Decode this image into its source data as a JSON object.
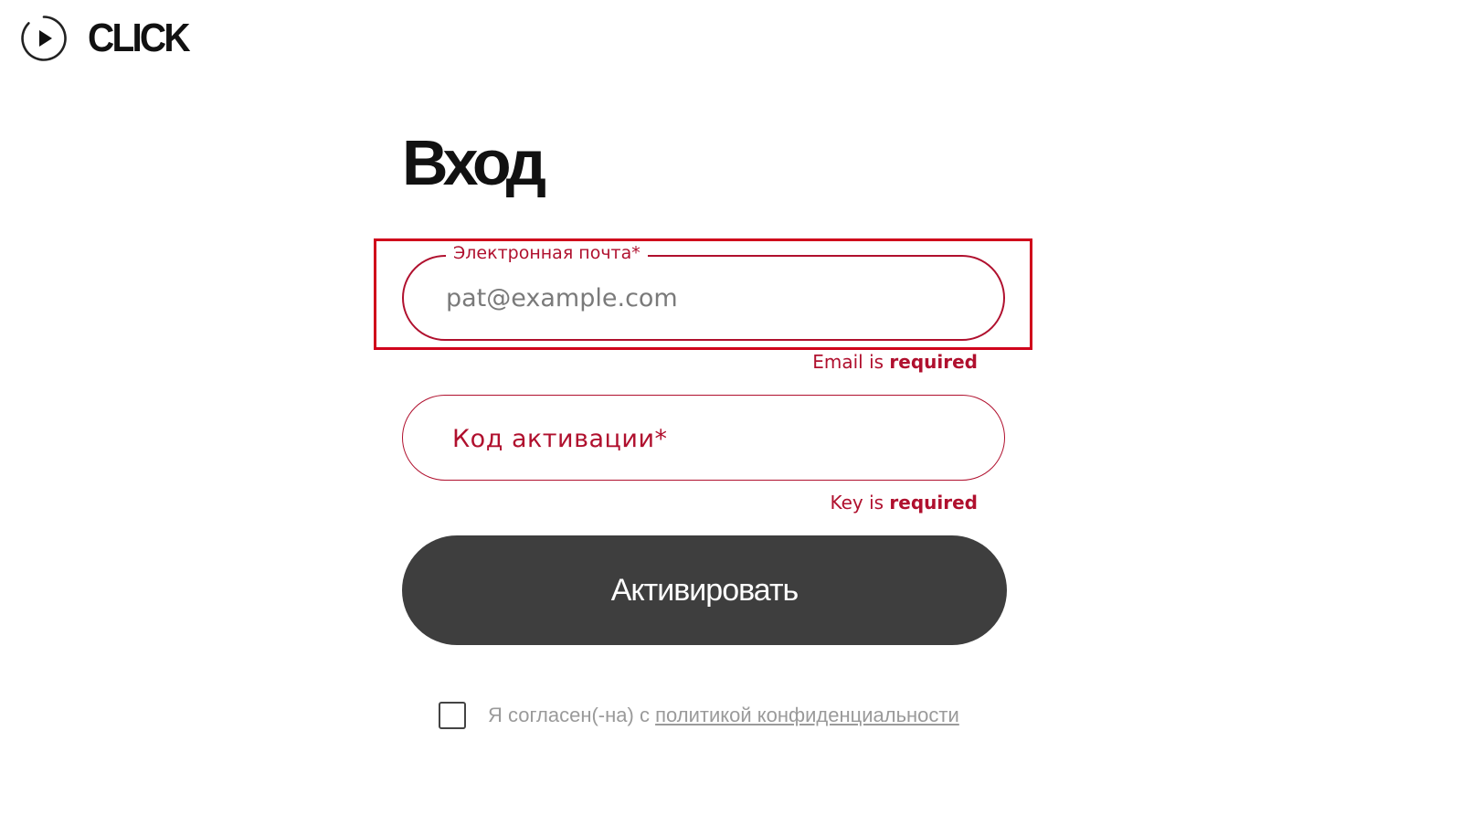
{
  "brand": {
    "logo_text": "CLICK",
    "icon": "play-circle-icon"
  },
  "page": {
    "title": "Вход"
  },
  "form": {
    "email": {
      "label": "Электронная почта*",
      "placeholder": "pat@example.com",
      "value": "",
      "error_prefix": "Email is ",
      "error_strong": "required"
    },
    "key": {
      "label": "Код активации*",
      "value": "",
      "error_prefix": "Key is ",
      "error_strong": "required"
    },
    "submit_label": "Активировать",
    "consent": {
      "checked": false,
      "text": "Я согласен(-на) с ",
      "link_text": "политикой конфиденциальности"
    }
  },
  "colors": {
    "accent": "#b0102e",
    "highlight": "#d0021b",
    "button_bg": "#3e3e3e",
    "muted_text": "#9a9a9a"
  }
}
